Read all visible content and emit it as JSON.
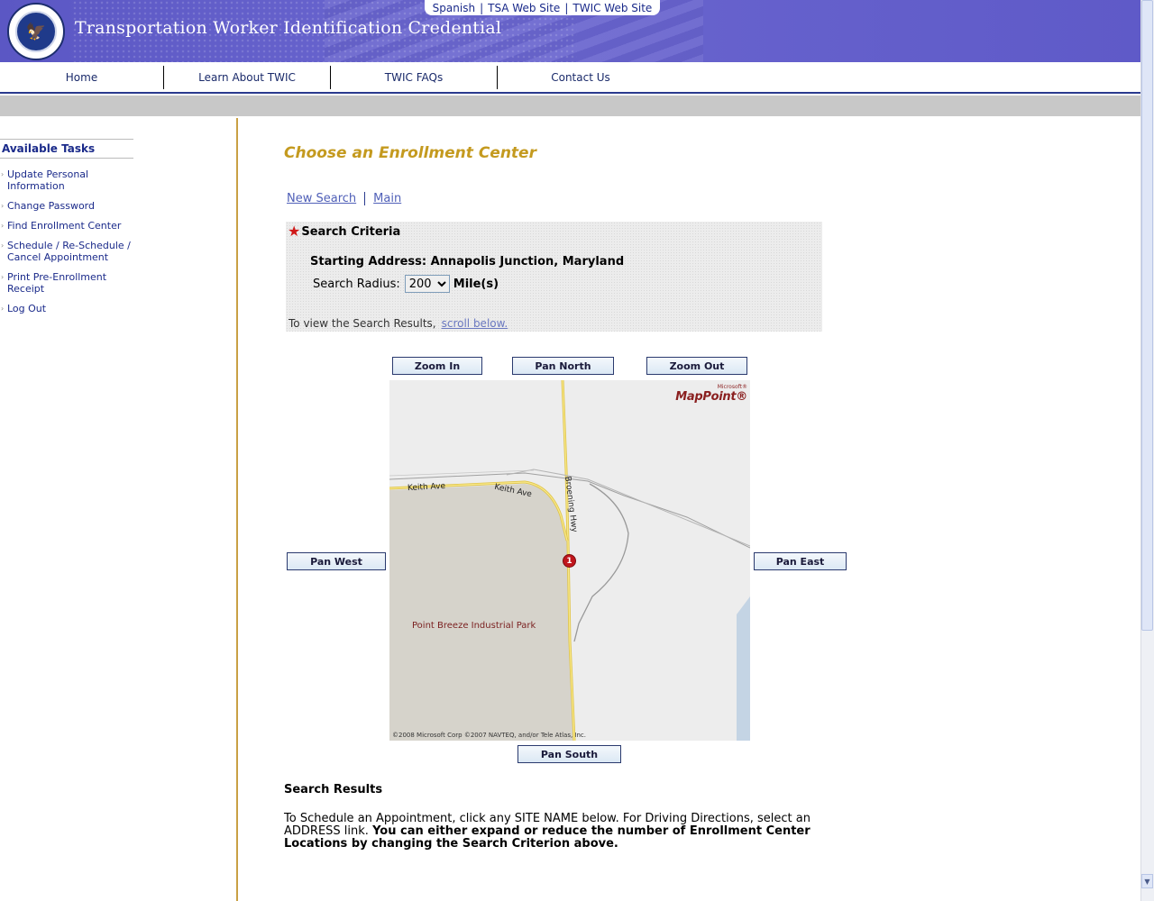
{
  "header": {
    "site_title": "Transportation Worker Identification Credential",
    "util_links": [
      "Spanish",
      "TSA Web Site",
      "TWIC Web Site"
    ],
    "seal_icon": "dhs-seal-icon"
  },
  "nav": {
    "items": [
      "Home",
      "Learn About TWIC",
      "TWIC FAQs",
      "Contact Us"
    ]
  },
  "sidebar": {
    "title": "Available Tasks",
    "items": [
      "Update Personal Information",
      "Change Password",
      "Find Enrollment Center",
      "Schedule / Re-Schedule / Cancel Appointment",
      "Print Pre-Enrollment Receipt",
      "Log Out"
    ]
  },
  "main": {
    "page_title": "Choose an Enrollment Center",
    "links": [
      "New Search",
      "Main"
    ],
    "criteria": {
      "heading": "Search Criteria",
      "starting_address": "Starting Address: Annapolis Junction, Maryland",
      "radius_label": "Search Radius:",
      "radius_value": "200",
      "radius_unit": "Mile(s)",
      "note": "To view the Search Results,",
      "note_link": "scroll below."
    },
    "map": {
      "buttons": {
        "zoom_in": "Zoom In",
        "pan_north": "Pan North",
        "zoom_out": "Zoom Out",
        "pan_west": "Pan West",
        "pan_east": "Pan East",
        "pan_south": "Pan South"
      },
      "logo_small": "Microsoft®",
      "logo": "MapPoint®",
      "copyright": "©2008 Microsoft Corp ©2007 NAVTEQ, and/or Tele Atlas, Inc.",
      "park_label": "Point Breeze Industrial Park",
      "road_labels": [
        "Keith Ave",
        "Keith Ave",
        "Broening Hwy"
      ],
      "pin_label": "1"
    },
    "results": {
      "heading": "Search Results",
      "text_plain": "To Schedule an Appointment, click any SITE NAME below. For Driving Directions, select an ADDRESS link.",
      "text_bold": "You can either expand or reduce the number of Enrollment Center Locations by changing the Search Criterion above."
    }
  }
}
